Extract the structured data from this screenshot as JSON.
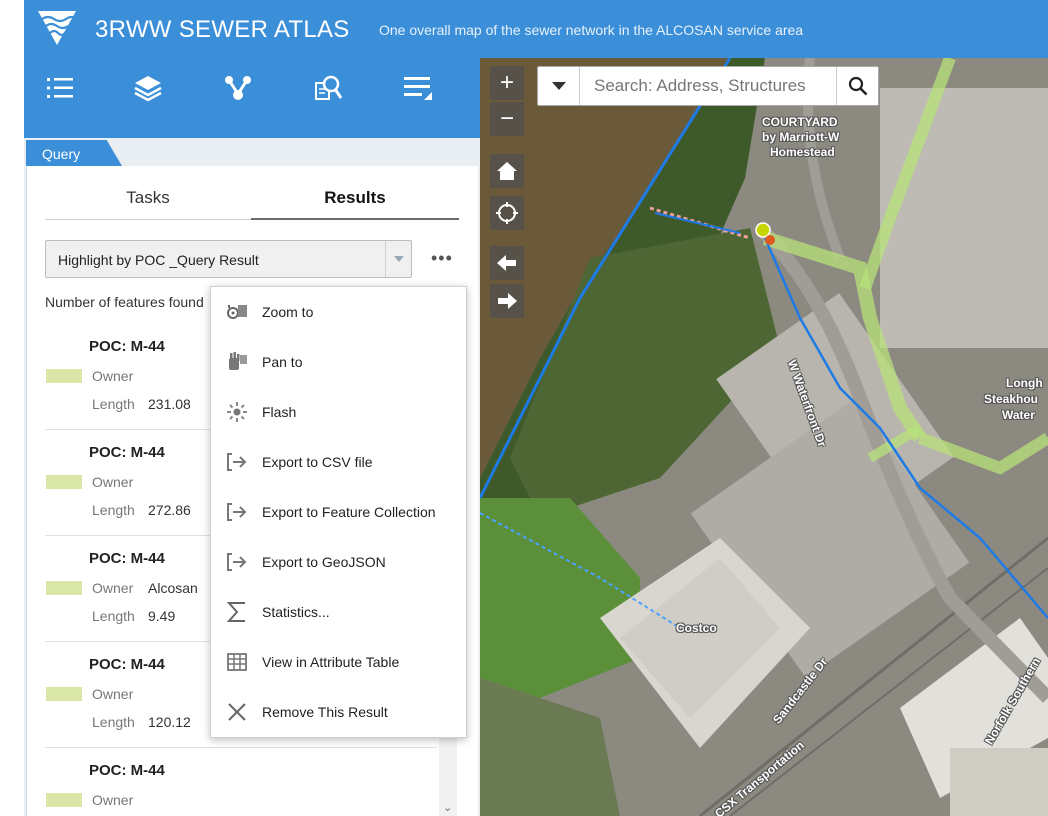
{
  "header": {
    "title": "3RWW SEWER ATLAS",
    "subtitle": "One overall map of the sewer network in the ALCOSAN service area"
  },
  "toolbar": {
    "icons": [
      "legend-list-icon",
      "layers-icon",
      "network-trace-icon",
      "query-search-icon",
      "menu-collapse-icon"
    ]
  },
  "panel": {
    "tab_label": "Query",
    "tabs": [
      "Tasks",
      "Results"
    ],
    "active_tab": "Results",
    "select_value": "Highlight by POC _Query Result",
    "more_label": "•••",
    "count_text": "Number of features found"
  },
  "results": [
    {
      "title": "POC: M-44",
      "owner_label": "Owner",
      "owner": "",
      "length_label": "Length",
      "length": "231.08"
    },
    {
      "title": "POC: M-44",
      "owner_label": "Owner",
      "owner": "",
      "length_label": "Length",
      "length": "272.86"
    },
    {
      "title": "POC: M-44",
      "owner_label": "Owner",
      "owner": "Alcosan",
      "length_label": "Length",
      "length": "9.49"
    },
    {
      "title": "POC: M-44",
      "owner_label": "Owner",
      "owner": "",
      "length_label": "Length",
      "length": "120.12"
    },
    {
      "title": "POC: M-44",
      "owner_label": "Owner",
      "owner": "",
      "length_label": "",
      "length": ""
    }
  ],
  "menu": {
    "items": [
      {
        "label": "Zoom to",
        "icon": "zoom-to-icon"
      },
      {
        "label": "Pan to",
        "icon": "pan-hand-icon"
      },
      {
        "label": "Flash",
        "icon": "flash-icon"
      },
      {
        "label": "Export to CSV file",
        "icon": "export-icon"
      },
      {
        "label": "Export to Feature Collection",
        "icon": "export-icon"
      },
      {
        "label": "Export to GeoJSON",
        "icon": "export-icon"
      },
      {
        "label": "Statistics...",
        "icon": "sigma-icon"
      },
      {
        "label": "View in Attribute Table",
        "icon": "table-icon"
      },
      {
        "label": "Remove This Result",
        "icon": "close-icon"
      }
    ]
  },
  "map": {
    "zoom_in": "+",
    "zoom_out": "−",
    "search_placeholder": "Search: Address, Structures",
    "labels": {
      "courtyard": "COURTYARD",
      "courtyard2": "by Marriott-W",
      "courtyard3": "Homestead",
      "waterfront": "W Waterfront Dr",
      "costco": "Costco",
      "sandcastle": "Sandcastle Dr",
      "csx": "CSX Transportation",
      "norfolk": "Norfolk Southern",
      "longhorn": "Longh",
      "steakhouse": "Steakhou",
      "water": "Water"
    }
  },
  "colors": {
    "brand_blue": "#3b8fd9",
    "swatch": "#d9e6a8",
    "sewer_line": "#1e7be6",
    "highlight": "#b8e27a"
  }
}
